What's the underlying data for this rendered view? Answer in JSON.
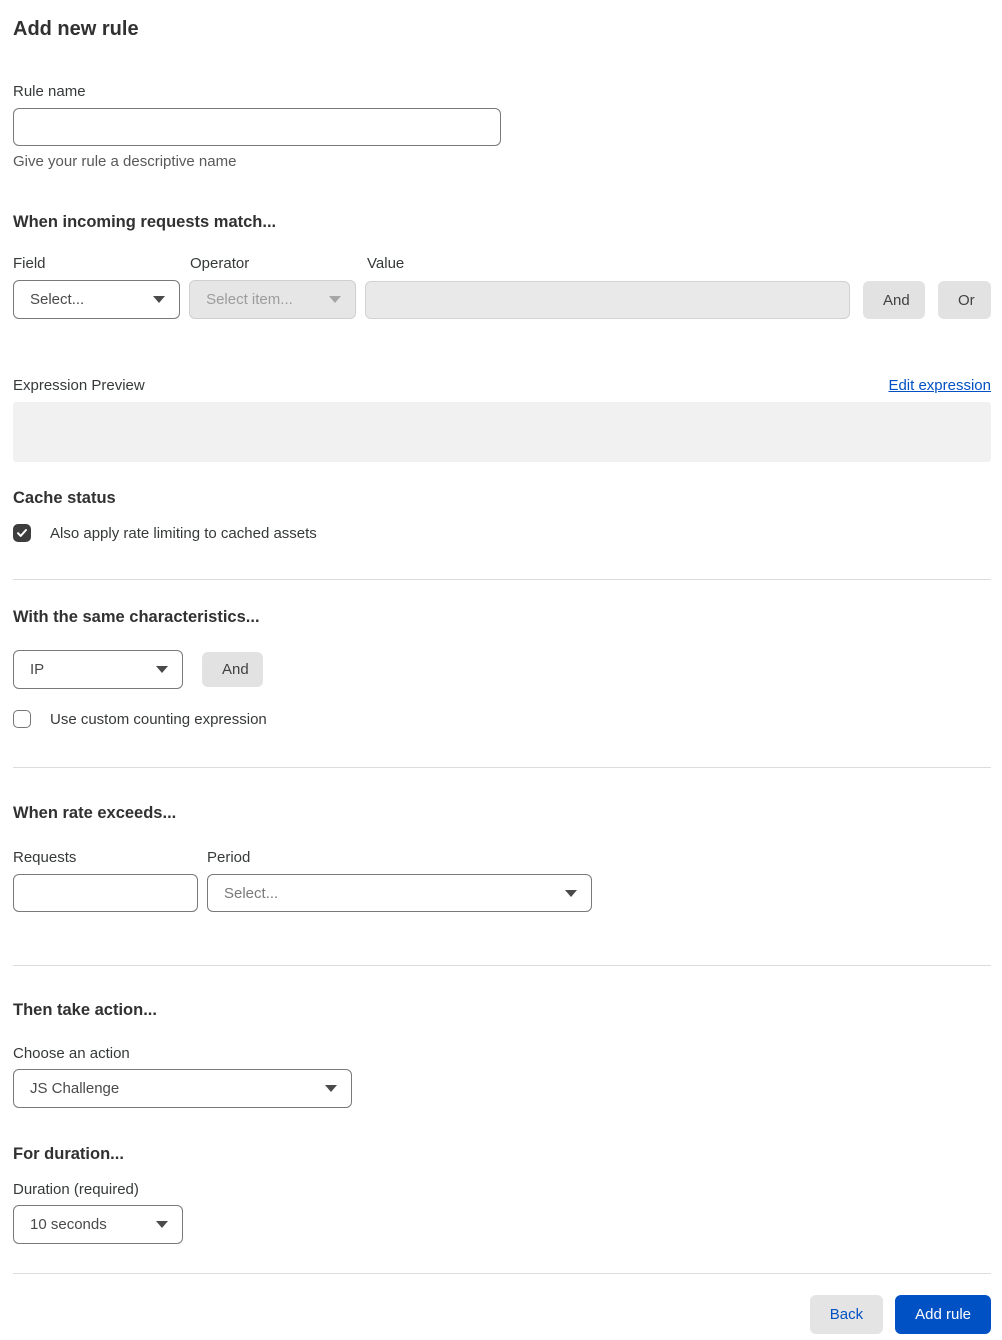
{
  "page": {
    "title": "Add new rule"
  },
  "rule_name": {
    "label": "Rule name",
    "value": "",
    "helper": "Give your rule a descriptive name"
  },
  "match": {
    "heading": "When incoming requests match...",
    "field_label": "Field",
    "field_value": "Select...",
    "operator_label": "Operator",
    "operator_value": "Select item...",
    "value_label": "Value",
    "value_value": "",
    "and_label": "And",
    "or_label": "Or"
  },
  "expression": {
    "label": "Expression Preview",
    "edit_link": "Edit expression",
    "value": ""
  },
  "cache": {
    "heading": "Cache status",
    "checkbox_label": "Also apply rate limiting to cached assets",
    "checked": true
  },
  "characteristics": {
    "heading": "With the same characteristics...",
    "select_value": "IP",
    "and_label": "And",
    "checkbox_label": "Use custom counting expression",
    "checked": false
  },
  "rate": {
    "heading": "When rate exceeds...",
    "requests_label": "Requests",
    "requests_value": "",
    "period_label": "Period",
    "period_value": "Select..."
  },
  "action": {
    "heading": "Then take action...",
    "label": "Choose an action",
    "value": "JS Challenge"
  },
  "duration": {
    "heading": "For duration...",
    "label": "Duration (required)",
    "value": "10 seconds"
  },
  "footer": {
    "back_label": "Back",
    "submit_label": "Add rule"
  },
  "colors": {
    "accent_blue": "#0051c3",
    "checkbox_checked": "#3d3d3d",
    "disabled_bg": "#e6e6e6",
    "preview_bg": "#f1f1f1"
  }
}
